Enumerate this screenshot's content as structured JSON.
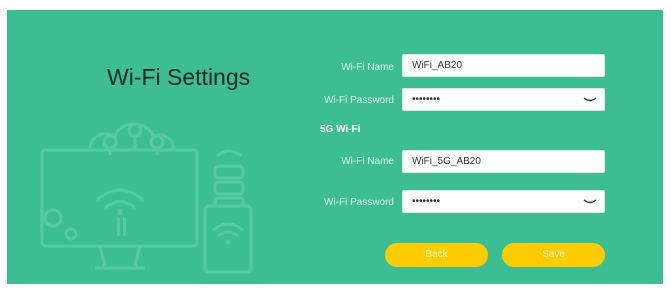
{
  "page": {
    "title": "Wi-Fi Settings"
  },
  "wifi_24": {
    "name_label": "Wi-Fi Name",
    "name_value": "WiFi_AB20",
    "password_label": "Wi-Fi Password",
    "password_value": "••••••••"
  },
  "wifi_5": {
    "section_label": "5G Wi-Fi",
    "name_label": "Wi-Fi Name",
    "name_value": "WiFi_5G_AB20",
    "password_label": "Wi-Fi Password",
    "password_value": "••••••••"
  },
  "actions": {
    "back_label": "Back",
    "save_label": "Save"
  },
  "colors": {
    "background": "#3dbd92",
    "button": "#ffcc00",
    "illustration": "#4fc79d"
  }
}
